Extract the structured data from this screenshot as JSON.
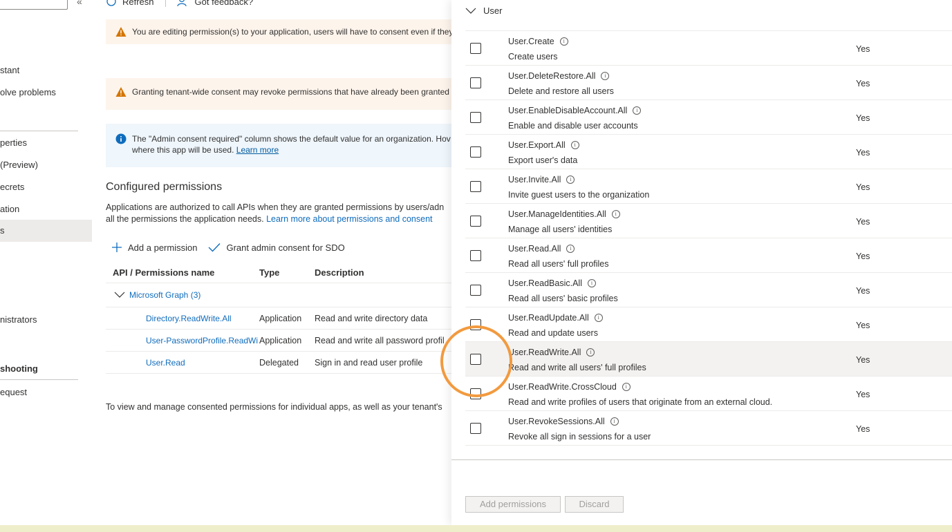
{
  "nav": {
    "collapse_glyph": "«",
    "items": [
      {
        "label": "stant"
      },
      {
        "label": "olve problems"
      },
      {
        "label": "perties"
      },
      {
        "label": " (Preview)"
      },
      {
        "label": "ecrets"
      },
      {
        "label": "ation"
      },
      {
        "label": "s"
      },
      {
        "label": "nistrators"
      },
      {
        "label": "shooting"
      },
      {
        "label": "equest"
      }
    ]
  },
  "toolbar": {
    "refresh_label": "Refresh",
    "feedback_label": "Got feedback?"
  },
  "banners": {
    "editing_warning": "You are editing permission(s) to your application, users will have to consent even if they",
    "consent_warning": "Granting tenant-wide consent may revoke permissions that have already been granted",
    "info_line1": "The \"Admin consent required\" column shows the default value for an organization. Hov",
    "info_line2": "where this app will be used.",
    "info_link": "Learn more"
  },
  "configured": {
    "title": "Configured permissions",
    "desc_line1": "Applications are authorized to call APIs when they are granted permissions by users/adn",
    "desc_line2": "all the permissions the application needs.",
    "desc_link": "Learn more about permissions and consent",
    "add_permission": "Add a permission",
    "grant_consent": "Grant admin consent for SDO",
    "columns": {
      "name": "API / Permissions name",
      "type": "Type",
      "desc": "Description"
    },
    "group_label": "Microsoft Graph (3)",
    "rows": [
      {
        "name": "Directory.ReadWrite.All",
        "type": "Application",
        "desc": "Read and write directory data"
      },
      {
        "name": "User-PasswordProfile.ReadWi",
        "type": "Application",
        "desc": "Read and write all password profil"
      },
      {
        "name": "User.Read",
        "type": "Delegated",
        "desc": "Sign in and read user profile"
      }
    ],
    "footer": "To view and manage consented permissions for individual apps, as well as your tenant's"
  },
  "panel": {
    "group_label": "User",
    "permissions": [
      {
        "name": "User.Create",
        "desc": "Create users",
        "admin": "Yes"
      },
      {
        "name": "User.DeleteRestore.All",
        "desc": "Delete and restore all users",
        "admin": "Yes"
      },
      {
        "name": "User.EnableDisableAccount.All",
        "desc": "Enable and disable user accounts",
        "admin": "Yes"
      },
      {
        "name": "User.Export.All",
        "desc": "Export user's data",
        "admin": "Yes"
      },
      {
        "name": "User.Invite.All",
        "desc": "Invite guest users to the organization",
        "admin": "Yes"
      },
      {
        "name": "User.ManageIdentities.All",
        "desc": "Manage all users' identities",
        "admin": "Yes"
      },
      {
        "name": "User.Read.All",
        "desc": "Read all users' full profiles",
        "admin": "Yes"
      },
      {
        "name": "User.ReadBasic.All",
        "desc": "Read all users' basic profiles",
        "admin": "Yes"
      },
      {
        "name": "User.ReadUpdate.All",
        "desc": "Read and update users",
        "admin": "Yes"
      },
      {
        "name": "User.ReadWrite.All",
        "desc": "Read and write all users' full profiles",
        "admin": "Yes"
      },
      {
        "name": "User.ReadWrite.CrossCloud",
        "desc": "Read and write profiles of users that originate from an external cloud.",
        "admin": "Yes"
      },
      {
        "name": "User.RevokeSessions.All",
        "desc": "Revoke all sign in sessions for a user",
        "admin": "Yes"
      }
    ],
    "add_button": "Add permissions",
    "discard_button": "Discard"
  },
  "colors": {
    "accent": "#0f6cbd",
    "warning": "#d47500",
    "highlight_ring": "#f29a3f"
  }
}
